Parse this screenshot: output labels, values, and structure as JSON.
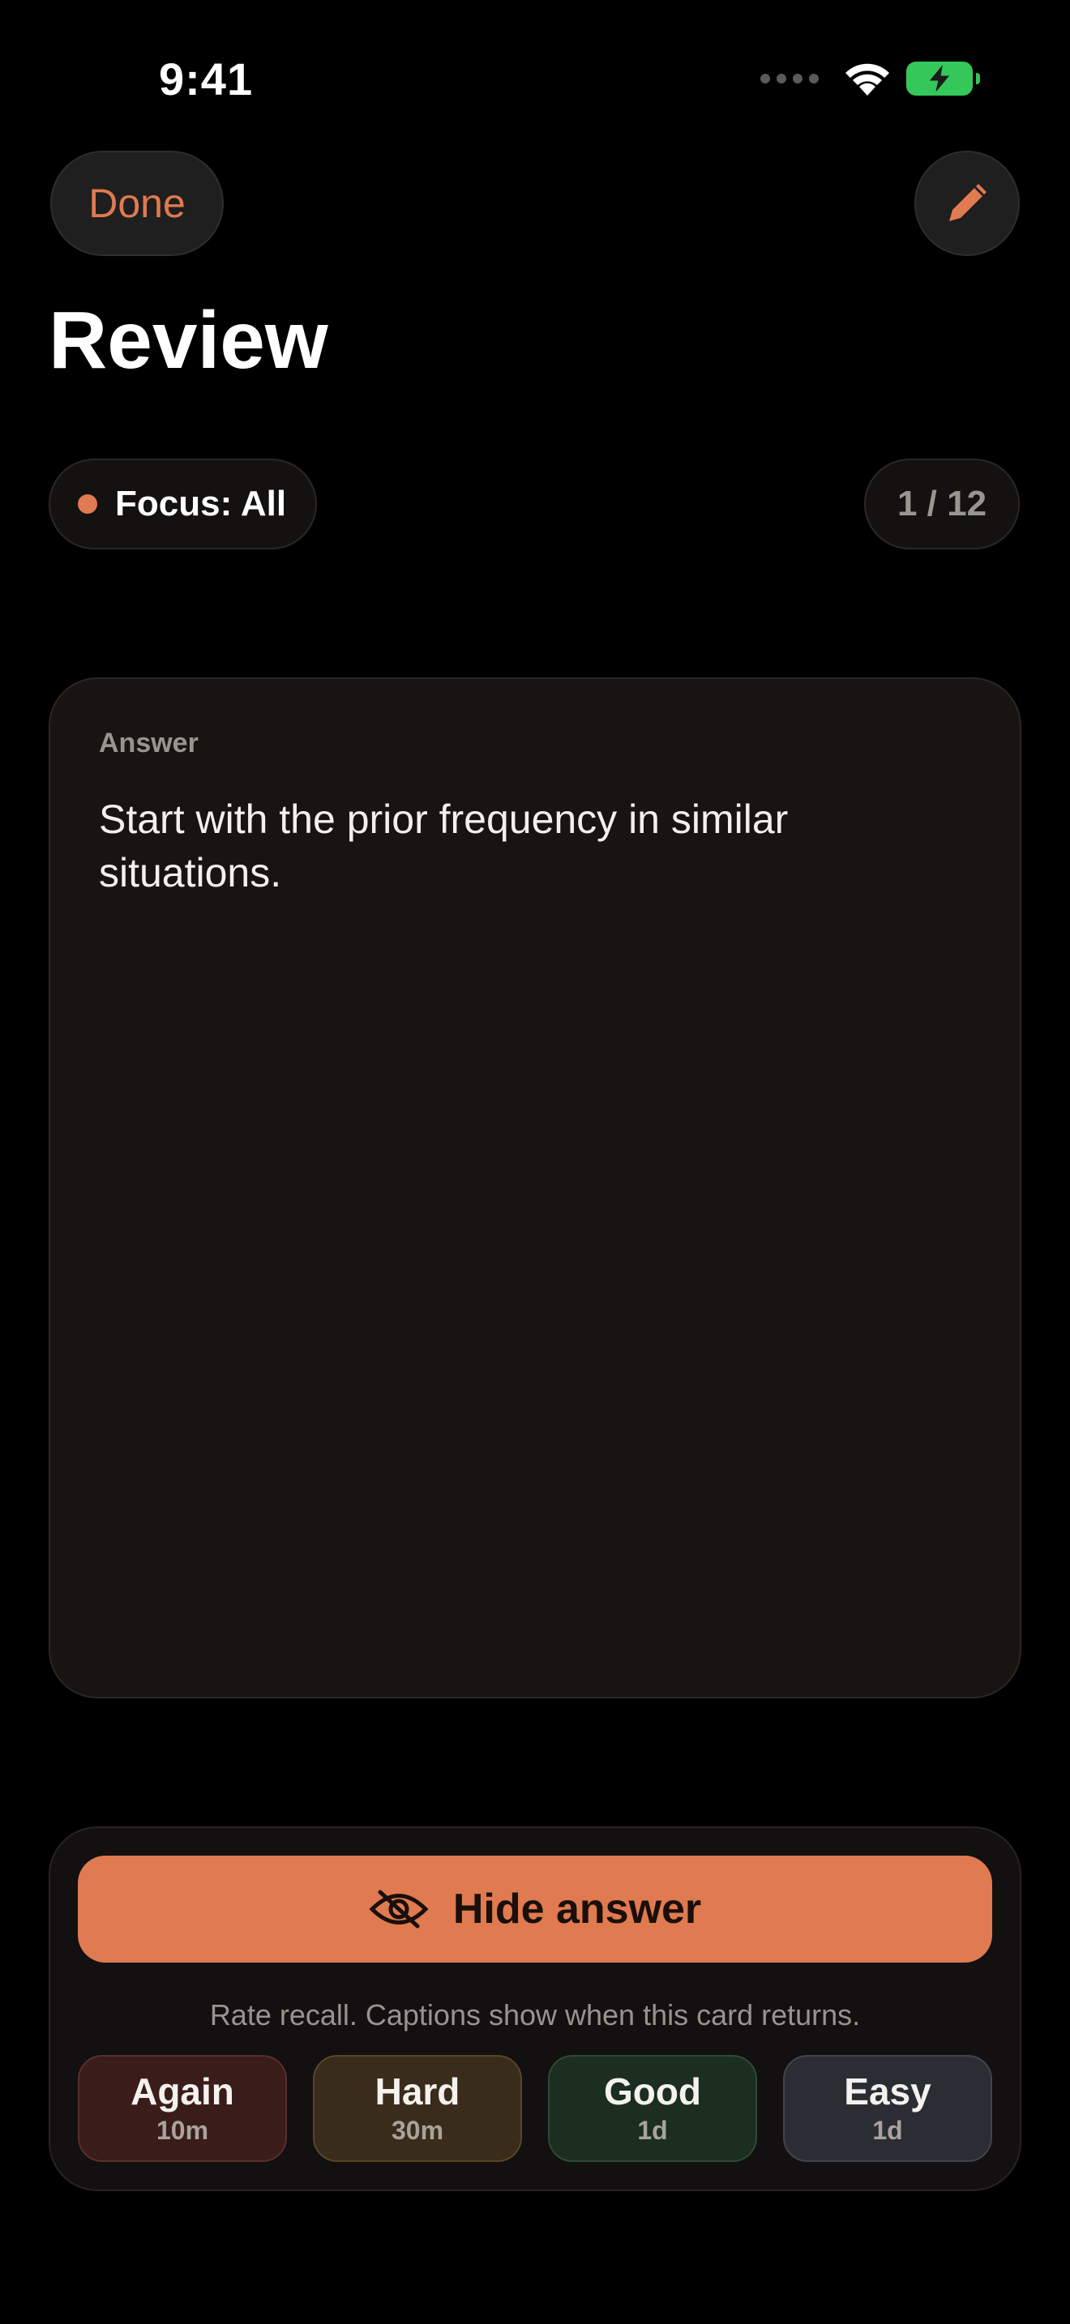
{
  "status_bar": {
    "time": "9:41"
  },
  "header": {
    "done_label": "Done",
    "title": "Review"
  },
  "filter": {
    "focus_label": "Focus: All",
    "counter": "1 / 12"
  },
  "card": {
    "label": "Answer",
    "text": "Start with the prior frequency in similar situations."
  },
  "actions": {
    "hide_label": "Hide answer",
    "caption": "Rate recall. Captions show when this card returns.",
    "ratings": [
      {
        "label": "Again",
        "interval": "10m"
      },
      {
        "label": "Hard",
        "interval": "30m"
      },
      {
        "label": "Good",
        "interval": "1d"
      },
      {
        "label": "Easy",
        "interval": "1d"
      }
    ]
  },
  "colors": {
    "accent": "#e07a50",
    "battery": "#34c759",
    "background": "#000000",
    "card": "#171412"
  },
  "icons": {
    "edit": "pencil-icon",
    "hide": "eye-slash-icon",
    "wifi": "wifi-icon",
    "battery": "battery-charging-icon",
    "signal": "cellular-signal-icon"
  }
}
